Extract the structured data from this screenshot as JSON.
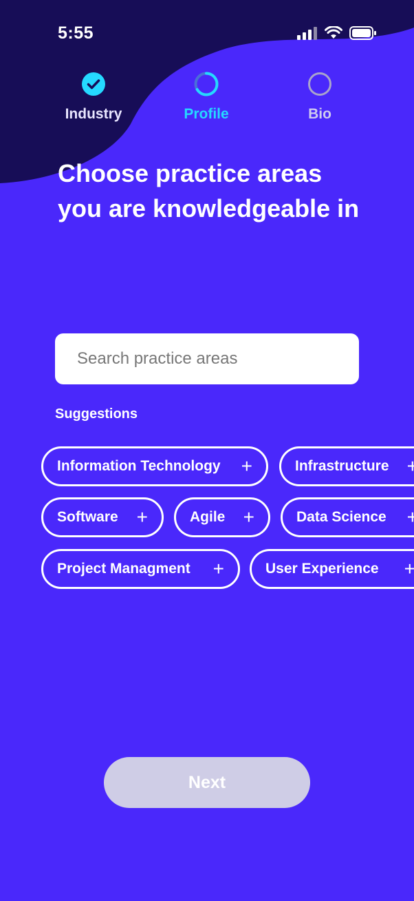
{
  "status_bar": {
    "time": "5:55"
  },
  "stepper": {
    "steps": [
      {
        "label": "Industry",
        "state": "completed"
      },
      {
        "label": "Profile",
        "state": "active"
      },
      {
        "label": "Bio",
        "state": "pending"
      }
    ]
  },
  "title": "Choose practice areas you are knowledgeable in",
  "search": {
    "placeholder": "Search practice areas",
    "value": ""
  },
  "suggestions": {
    "label": "Suggestions",
    "chips": [
      {
        "label": "Information Technology",
        "icon": "plus-icon"
      },
      {
        "label": "Infrastructure",
        "icon": "plus-icon"
      },
      {
        "label": "Software",
        "icon": "plus-icon"
      },
      {
        "label": "Agile",
        "icon": "plus-icon"
      },
      {
        "label": "Data Science",
        "icon": "plus-icon"
      },
      {
        "label": "Project Managment",
        "icon": "plus-icon"
      },
      {
        "label": "User Experience",
        "icon": "plus-icon"
      }
    ]
  },
  "next_button": {
    "label": "Next",
    "enabled": false
  },
  "colors": {
    "background": "#4a28fb",
    "header_wave": "#170d57",
    "accent": "#25d9ff",
    "next_disabled": "#cfcde6"
  }
}
